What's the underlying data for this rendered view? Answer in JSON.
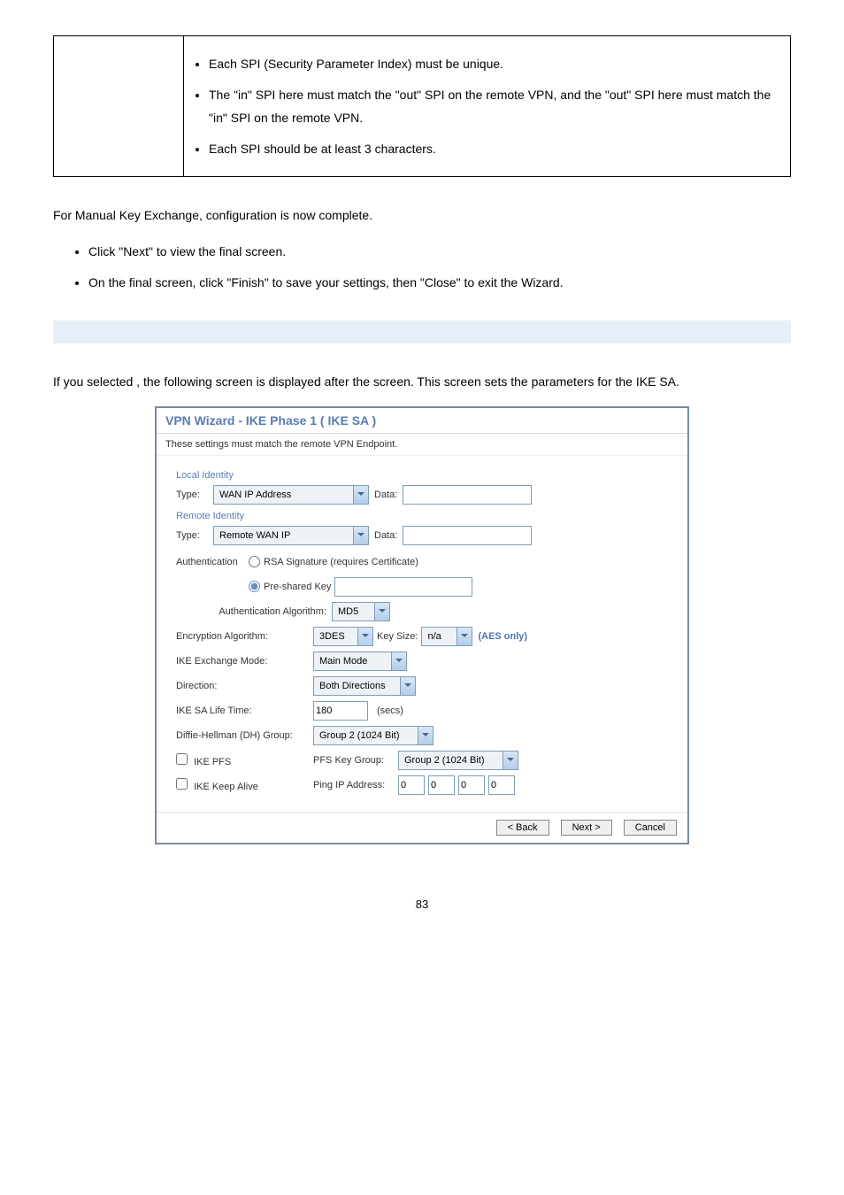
{
  "table": {
    "bullets": [
      "Each SPI (Security Parameter Index) must be unique.",
      "The \"in\" SPI here must match the \"out\" SPI on the remote VPN, and the \"out\" SPI here must match the \"in\" SPI on the remote VPN.",
      "Each SPI should be at least 3 characters."
    ]
  },
  "para1": "For Manual Key Exchange, configuration is now complete.",
  "list1": [
    "Click \"Next\" to view the final screen.",
    "On the final screen, click \"Finish\" to save your settings, then \"Close\" to exit the Wizard."
  ],
  "para2a": "If you selected ",
  "para2b": ", the following screen is displayed after the ",
  "para2c": " screen. This screen sets the parameters for the IKE SA.",
  "wizard": {
    "title": "VPN Wizard - IKE Phase 1 ( IKE SA )",
    "subtitle": "These settings must match the remote VPN Endpoint.",
    "local_identity": "Local Identity",
    "remote_identity": "Remote Identity",
    "type_label": "Type:",
    "data_label": "Data:",
    "local_type": "WAN IP Address",
    "remote_type": "Remote WAN IP",
    "auth_label": "Authentication",
    "rsa_label": "RSA Signature (requires Certificate)",
    "psk_label": "Pre-shared Key",
    "auth_algo_label": "Authentication Algorithm:",
    "auth_algo": "MD5",
    "enc_algo_label": "Encryption Algorithm:",
    "enc_algo": "3DES",
    "key_size_label": "Key Size:",
    "key_size": "n/a",
    "aes_note": "(AES only)",
    "ike_mode_label": "IKE Exchange Mode:",
    "ike_mode": "Main Mode",
    "direction_label": "Direction:",
    "direction": "Both Directions",
    "sa_life_label": "IKE SA Life Time:",
    "sa_life": "180",
    "secs": "(secs)",
    "dh_label": "Diffie-Hellman (DH) Group:",
    "dh_group": "Group 2 (1024 Bit)",
    "ike_pfs_label": "IKE PFS",
    "pfs_key_label": "PFS Key Group:",
    "pfs_key": "Group 2 (1024 Bit)",
    "keepalive_label": "IKE Keep Alive",
    "ping_label": "Ping IP Address:",
    "ip": [
      "0",
      "0",
      "0",
      "0"
    ],
    "back": "< Back",
    "next": "Next >",
    "cancel": "Cancel"
  },
  "page": "83"
}
